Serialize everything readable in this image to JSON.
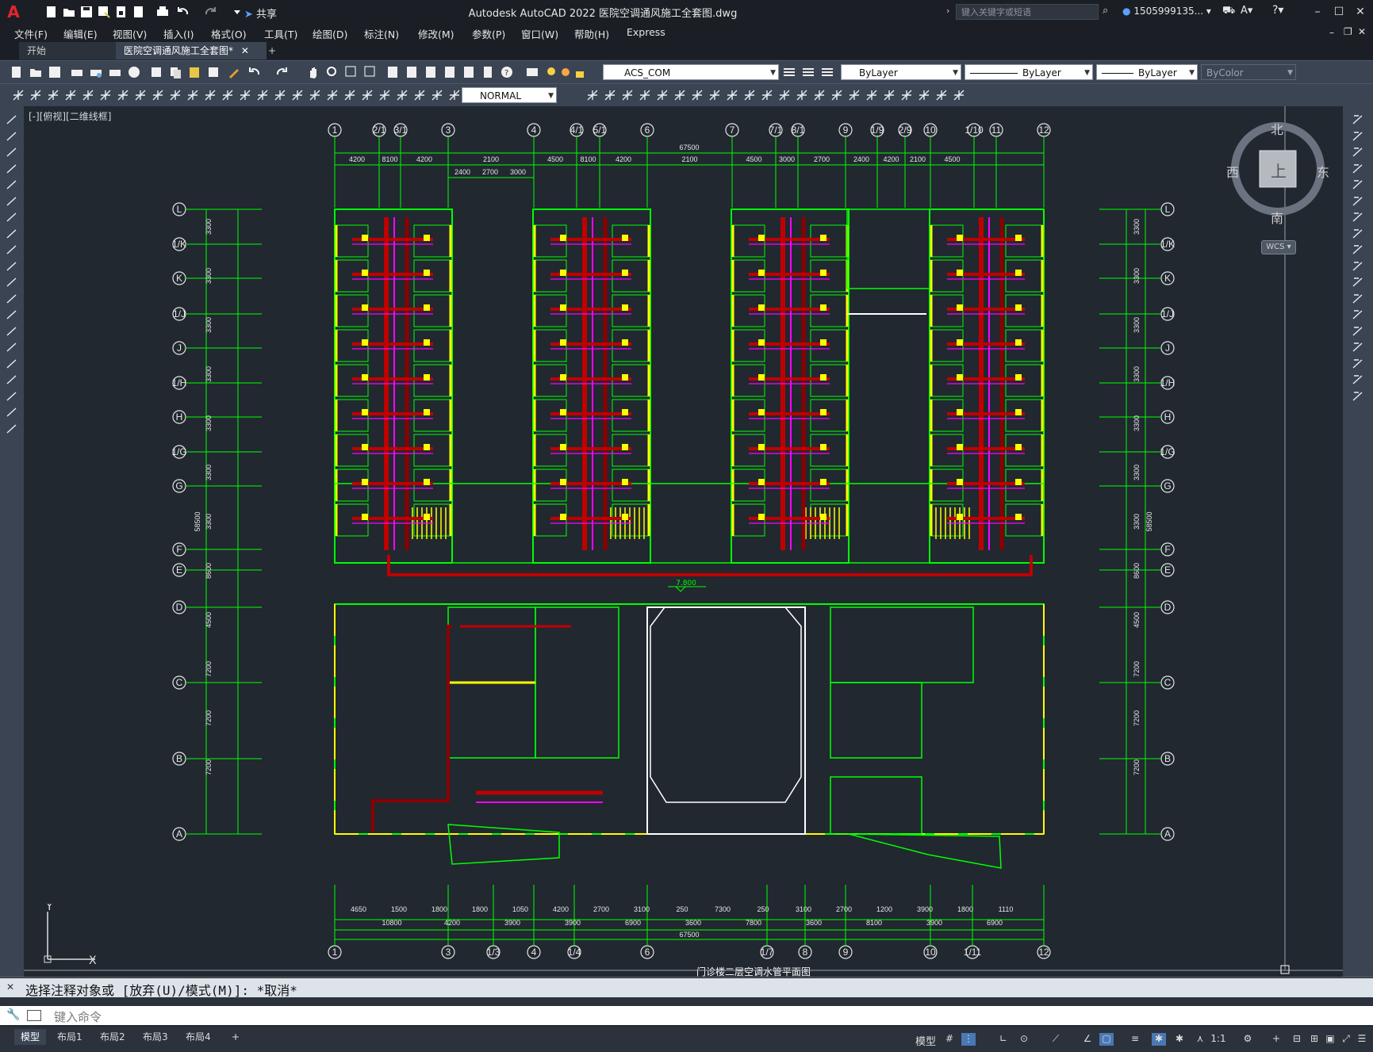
{
  "app": {
    "title": "Autodesk AutoCAD 2022    医院空调通风施工全套图.dwg",
    "share_label": "共享",
    "search_placeholder": "键入关键字或短语",
    "user": "1505999135..."
  },
  "menu": [
    "文件(F)",
    "编辑(E)",
    "视图(V)",
    "插入(I)",
    "格式(O)",
    "工具(T)",
    "绘图(D)",
    "标注(N)",
    "修改(M)",
    "参数(P)",
    "窗口(W)",
    "帮助(H)",
    "Express"
  ],
  "tabs": {
    "start": "开始",
    "doc": "医院空调通风施工全套图*",
    "add": "+"
  },
  "toolbar": {
    "layer": "ACS_COM",
    "color": "ByLayer",
    "linetype": "ByLayer",
    "lineweight": "ByLayer",
    "plotstyle": "ByColor",
    "dimstyle": "NORMAL"
  },
  "viewport": {
    "label": "[-][俯视][二维线框]"
  },
  "viewcube": {
    "north": "北",
    "south": "南",
    "west": "西",
    "east": "东",
    "face": "上",
    "wcs": "WCS"
  },
  "drawing": {
    "top_grid": [
      "1",
      "2/1",
      "3/1",
      "3",
      "4",
      "4/1",
      "5/1",
      "6",
      "7",
      "7/1",
      "8/1",
      "9",
      "1/9",
      "2/9",
      "10",
      "1/10",
      "11",
      "12"
    ],
    "bottom_grid": [
      "1",
      "3",
      "1/3",
      "4",
      "1/4",
      "6",
      "1/7",
      "8",
      "9",
      "10",
      "1/11",
      "12"
    ],
    "row_grid": [
      "L",
      "1/K",
      "K",
      "1/J",
      "J",
      "1/H",
      "H",
      "1/G",
      "G",
      "F",
      "E",
      "D",
      "C",
      "B",
      "A"
    ],
    "top_total": "67500",
    "top_dims": [
      "4200",
      "8100",
      "4200",
      "2100",
      "4500",
      "8100",
      "4200",
      "2100",
      "4500",
      "3000",
      "2700",
      "2400",
      "4200",
      "2100",
      "4500"
    ],
    "top_sub_dims": [
      "2400",
      "2700",
      "3000"
    ],
    "bottom_total": "67500",
    "bottom_dims_a": [
      "4650",
      "1500",
      "1800",
      "1800",
      "1050",
      "4200",
      "2700",
      "3100",
      "250",
      "7300",
      "250",
      "3100",
      "2700",
      "1200",
      "3900",
      "1800",
      "1110"
    ],
    "bottom_dims_b": [
      "10800",
      "4200",
      "3900",
      "3900",
      "6900",
      "3600",
      "7800",
      "3600",
      "8100",
      "3900",
      "6900"
    ],
    "left_dims": [
      "3300",
      "3300",
      "3300",
      "3300",
      "3300",
      "3300",
      "3300",
      "8600",
      "4500",
      "7200",
      "7200",
      "7200"
    ],
    "left_total": "58500",
    "elevation": "7.800",
    "title": "门诊楼二层空调水管平面图"
  },
  "command": {
    "history": "选择注释对象或 [放弃(U)/模式(M)]: *取消*",
    "placeholder": "键入命令"
  },
  "layouts": [
    "模型",
    "布局1",
    "布局2",
    "布局3",
    "布局4"
  ],
  "status": {
    "model": "模型",
    "scale": "1:1"
  },
  "colors": {
    "green": "#00ff00",
    "red": "#d40000",
    "yellow": "#ffff00",
    "magenta": "#ff00ff",
    "bg": "#212830"
  }
}
